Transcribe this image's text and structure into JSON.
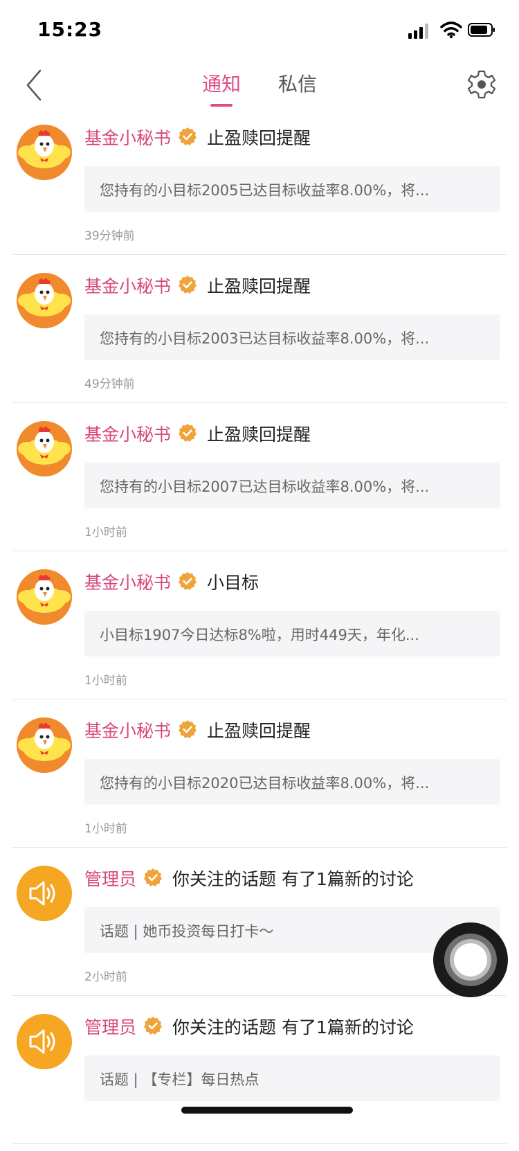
{
  "status_bar": {
    "time": "15:23"
  },
  "nav": {
    "tabs": [
      {
        "label": "通知",
        "active": true
      },
      {
        "label": "私信",
        "active": false
      }
    ]
  },
  "colors": {
    "accent": "#e04a86",
    "name": "#d9467e",
    "verified": "#f0a33a"
  },
  "items": [
    {
      "avatar": "chick-icon",
      "name": "基金小秘书",
      "title": "止盈赎回提醒",
      "content": "您持有的小目标2005已达目标收益率8.00%，将...",
      "time": "39分钟前"
    },
    {
      "avatar": "chick-icon",
      "name": "基金小秘书",
      "title": "止盈赎回提醒",
      "content": "您持有的小目标2003已达目标收益率8.00%，将...",
      "time": "49分钟前"
    },
    {
      "avatar": "chick-icon",
      "name": "基金小秘书",
      "title": "止盈赎回提醒",
      "content": "您持有的小目标2007已达目标收益率8.00%，将...",
      "time": "1小时前"
    },
    {
      "avatar": "chick-icon",
      "name": "基金小秘书",
      "title": "小目标",
      "content": "小目标1907今日达标8%啦，用时449天，年化...",
      "time": "1小时前"
    },
    {
      "avatar": "chick-icon",
      "name": "基金小秘书",
      "title": "止盈赎回提醒",
      "content": "您持有的小目标2020已达目标收益率8.00%，将...",
      "time": "1小时前"
    },
    {
      "avatar": "speaker-icon",
      "name": "管理员",
      "title": "你关注的话题 有了1篇新的讨论",
      "content": "话题 | 她币投资每日打卡～",
      "time": "2小时前"
    },
    {
      "avatar": "speaker-icon",
      "name": "管理员",
      "title": "你关注的话题 有了1篇新的讨论",
      "content": "话题 | 【专栏】每日热点",
      "time": ""
    }
  ]
}
